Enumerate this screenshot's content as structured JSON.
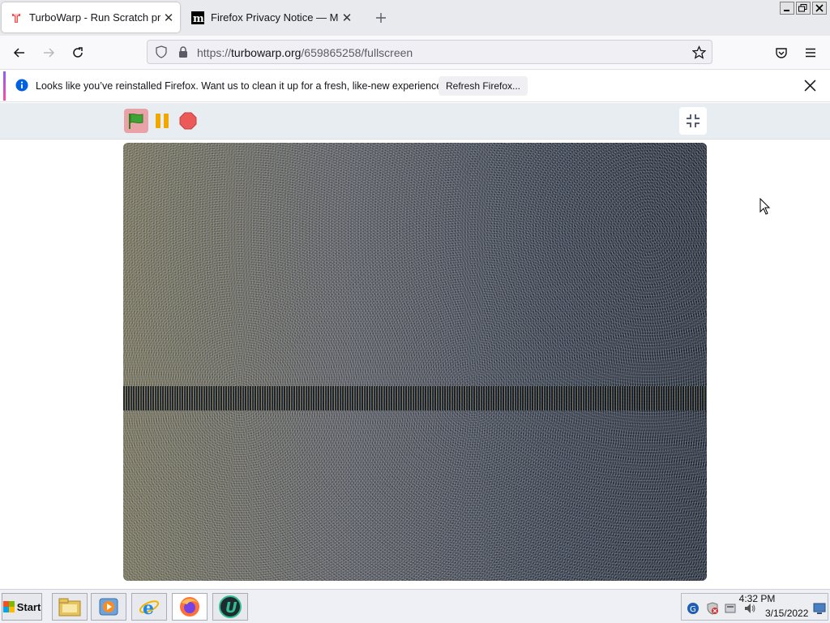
{
  "browser": {
    "tabs": [
      {
        "title": "TurboWarp - Run Scratch projects",
        "active": true,
        "favicon": "turbowarp-icon"
      },
      {
        "title": "Firefox Privacy Notice — Mozilla",
        "active": false,
        "favicon": "mozilla-m-icon"
      }
    ],
    "new_tab_icon": "plus-icon",
    "url": {
      "prefix": "https://",
      "host": "turbowarp.org",
      "path": "/659865258/fullscreen"
    },
    "nav_icons": [
      "back-arrow-icon",
      "forward-arrow-icon",
      "reload-icon",
      "shield-icon",
      "lock-icon",
      "bookmark-star-icon",
      "pocket-icon",
      "hamburger-menu-icon"
    ]
  },
  "notification": {
    "message": "Looks like you’ve reinstalled Firefox. Want us to clean it up for a fresh, like-new experience?",
    "button_label": "Refresh Firefox...",
    "accent_colors": [
      "#9059ff",
      "#ff4aa2"
    ]
  },
  "turbowarp": {
    "controls": [
      "green-flag-icon",
      "pause-icon",
      "stop-icon",
      "exit-fullscreen-icon"
    ],
    "flag_color": "#3fa435",
    "pause_color": "#f0a800",
    "stop_color": "#ec5959"
  },
  "taskbar": {
    "start_label": "Start",
    "quick_launch": [
      "file-explorer-icon",
      "media-player-icon",
      "internet-explorer-icon",
      "firefox-icon",
      "ublock-u-icon"
    ],
    "tray_icons": [
      "network-globe-icon",
      "security-alert-icon",
      "device-icon",
      "volume-icon"
    ],
    "time": "4:32 PM",
    "date": "3/15/2022"
  }
}
